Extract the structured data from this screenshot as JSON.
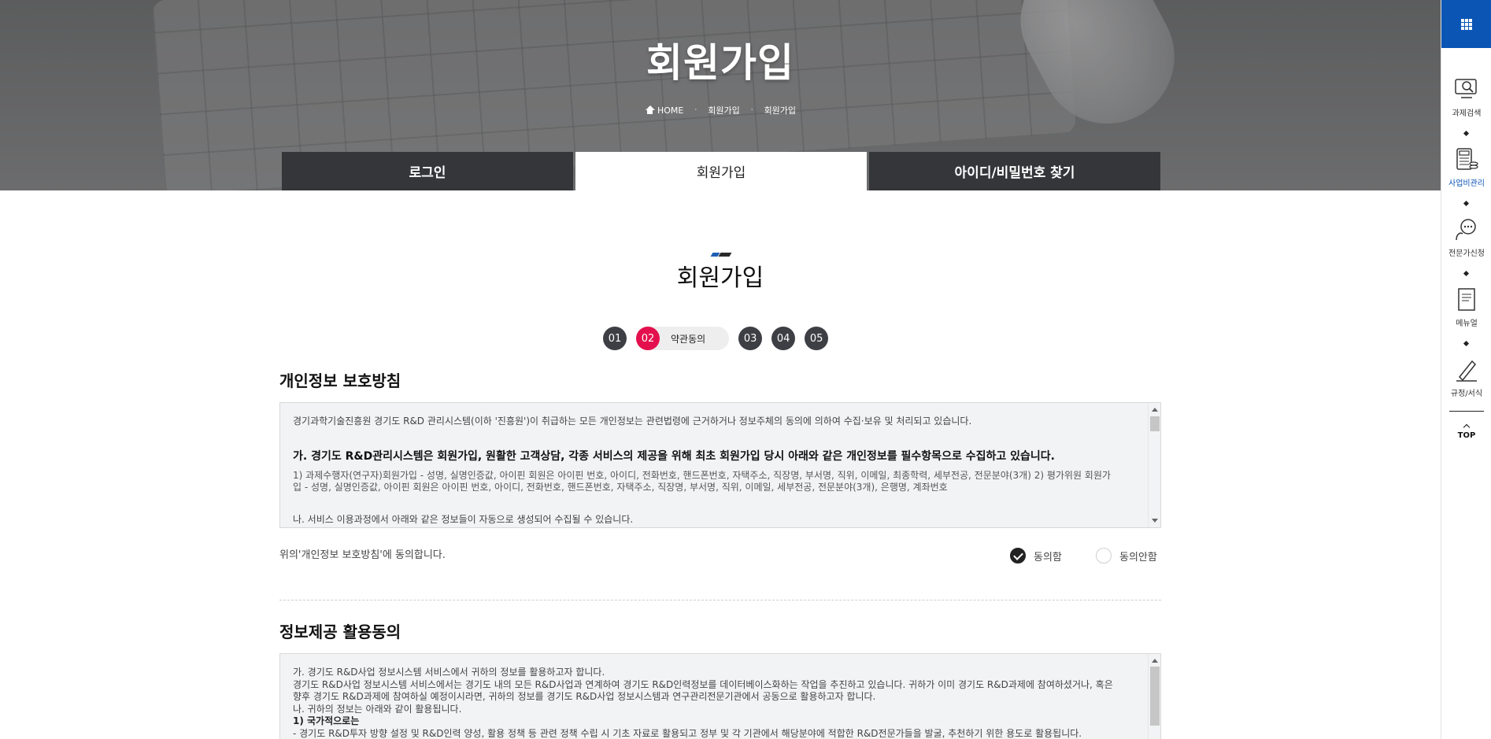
{
  "hero": {
    "title": "회원가입",
    "breadcrumb": {
      "home": "HOME",
      "level1": "회원가입",
      "level2": "회원가입",
      "separator": "·"
    }
  },
  "tabs": [
    {
      "label": "로그인",
      "active": false
    },
    {
      "label": "회원가입",
      "active": true
    },
    {
      "label": "아이디/비밀번호 찾기",
      "active": false
    }
  ],
  "page_title": "회원가입",
  "steps": {
    "items": [
      "01",
      "02",
      "03",
      "04",
      "05"
    ],
    "current": "02",
    "current_label": "약관동의",
    "active_color": "#e4104d"
  },
  "privacy": {
    "title": "개인정보 보호방침",
    "intro": "경기과학기술진흥원 경기도 R&D 관리시스템(이하 '진흥원')이 취급하는 모든 개인정보는 관련법령에 근거하거나 정보주체의 동의에 의하여 수집·보유 및 처리되고 있습니다.",
    "heading": "가. 경기도 R&D관리시스템은 회원가입, 원활한 고객상담, 각종 서비스의 제공을 위해 최초 회원가입 당시 아래와 같은 개인정보를 필수항목으로 수집하고 있습니다.",
    "body": "1) 과제수행자(연구자)회원가입 - 성명, 실명인증값, 아이핀 회원은 아이핀 번호, 아이디, 전화번호, 핸드폰번호, 자택주소, 직장명, 부서명, 직위, 이메일, 최종학력, 세부전공, 전문분야(3개) 2) 평가위원 회원가입 - 성명, 실명인증값, 아이핀 회원은 아이핀 번호, 아이디, 전화번호, 핸드폰번호, 자택주소, 직장명, 부서명, 직위, 이메일, 세부전공, 전문분야(3개), 은행명, 계좌번호",
    "cut_line": "나. 서비스 이용과정에서 아래와 같은 정보들이 자동으로 생성되어 수집될 수 있습니다.",
    "agree_question": "위의'개인정보 보호방침'에 동의합니다.",
    "agree_label": "동의함",
    "disagree_label": "동의안함",
    "selected": "agree"
  },
  "info_use": {
    "title": "정보제공 활용동의",
    "lines": [
      "가. 경기도 R&D사업 정보시스템 서비스에서 귀하의 정보를 활용하고자 합니다.",
      "경기도 R&D사업 정보시스템 서비스에서는 경기도 내의 모든 R&D사업과 연계하여 경기도 R&D인력정보를 데이터베이스화하는 작업을 추진하고 있습니다. 귀하가 이미 경기도 R&D과제에 참여하셨거나, 혹은 향후 경기도 R&D과제에 참여하실 예정이시라면, 귀하의 정보를 경기도 R&D사업 정보시스템과 연구관리전문기관에서 공동으로 활용하고자 합니다.",
      "나. 귀하의 정보는 아래와 같이 활용됩니다.",
      "1) 국가적으로는",
      "- 경기도 R&D투자 방향 설정 및 R&D인력 양성, 활용 정책 등 관련 정책 수립 시 기초 자료로 활용되고 정부 및 각 기관에서 해당분야에 적합한 R&D전문가들을 발굴, 추천하기 위한 용도로 활용됩니다."
    ]
  },
  "quickbar": {
    "items": [
      {
        "label": "과제검색",
        "icon": "search-monitor-icon"
      },
      {
        "label": "사업비관리",
        "icon": "calculator-coins-icon",
        "active": true
      },
      {
        "label": "전문가신청",
        "icon": "expert-bulb-icon"
      },
      {
        "label": "메뉴얼",
        "icon": "manual-book-icon"
      },
      {
        "label": "규정/서식",
        "icon": "pen-document-icon"
      }
    ],
    "top_label": "TOP",
    "accent": "#0b55b5"
  }
}
